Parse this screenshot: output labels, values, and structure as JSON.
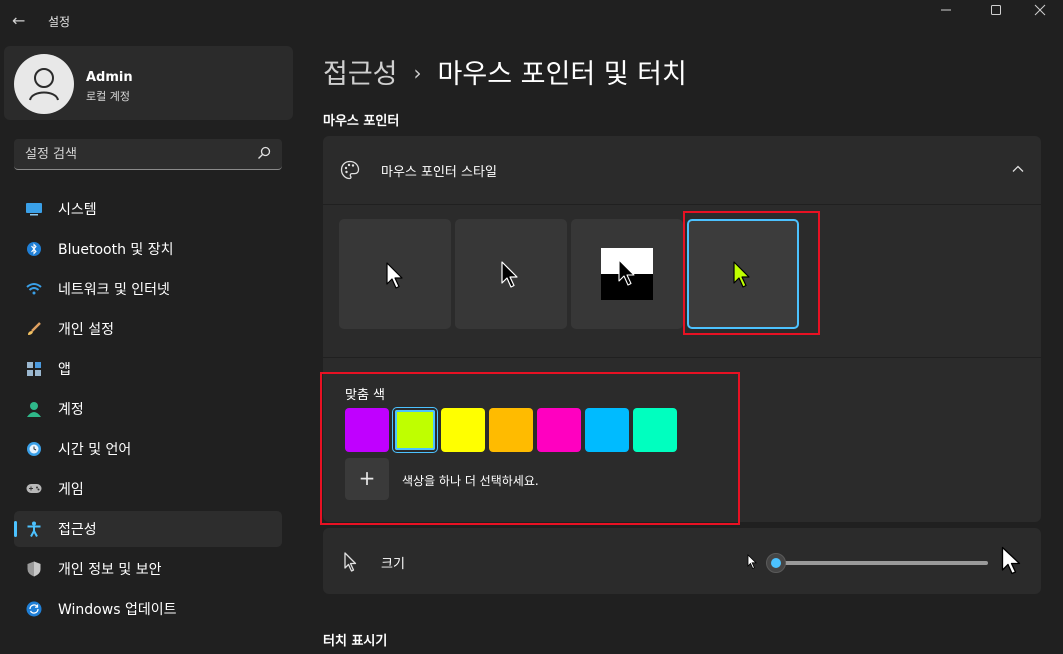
{
  "window": {
    "title": "설정",
    "back_glyph": "←"
  },
  "colors": {
    "accent": "#4cc2ff",
    "highlight_box": "#e81123"
  },
  "profile": {
    "name": "Admin",
    "account_type": "로컬 계정"
  },
  "search": {
    "placeholder": "설정 검색"
  },
  "nav": {
    "items": [
      {
        "label": "시스템",
        "icon": "system-icon"
      },
      {
        "label": "Bluetooth 및 장치",
        "icon": "bluetooth-icon"
      },
      {
        "label": "네트워크 및 인터넷",
        "icon": "wifi-icon"
      },
      {
        "label": "개인 설정",
        "icon": "brush-icon"
      },
      {
        "label": "앱",
        "icon": "apps-icon"
      },
      {
        "label": "계정",
        "icon": "account-icon"
      },
      {
        "label": "시간 및 언어",
        "icon": "clock-globe-icon"
      },
      {
        "label": "게임",
        "icon": "gamepad-icon"
      },
      {
        "label": "접근성",
        "icon": "accessibility-icon",
        "active": true
      },
      {
        "label": "개인 정보 및 보안",
        "icon": "shield-icon"
      },
      {
        "label": "Windows 업데이트",
        "icon": "update-icon"
      }
    ]
  },
  "breadcrumb": {
    "parent": "접근성",
    "separator": "›",
    "current": "마우스 포인터 및 터치"
  },
  "sections": {
    "pointer": "마우스 포인터",
    "touch": "터치 표시기"
  },
  "pointer_style": {
    "label": "마우스 포인터 스타일",
    "styles": [
      "white",
      "black",
      "inverted",
      "custom"
    ],
    "selected_style": "custom"
  },
  "custom_color": {
    "label": "맞춤 색",
    "swatches": [
      "#c000ff",
      "#bfff00",
      "#ffff00",
      "#ffbb00",
      "#ff00c0",
      "#00bbff",
      "#00ffbf"
    ],
    "selected_swatch": "#bfff00",
    "more_label": "색상을 하나 더 선택하세요.",
    "plus_glyph": "+"
  },
  "size": {
    "label": "크기",
    "value_fraction": 0.0
  }
}
